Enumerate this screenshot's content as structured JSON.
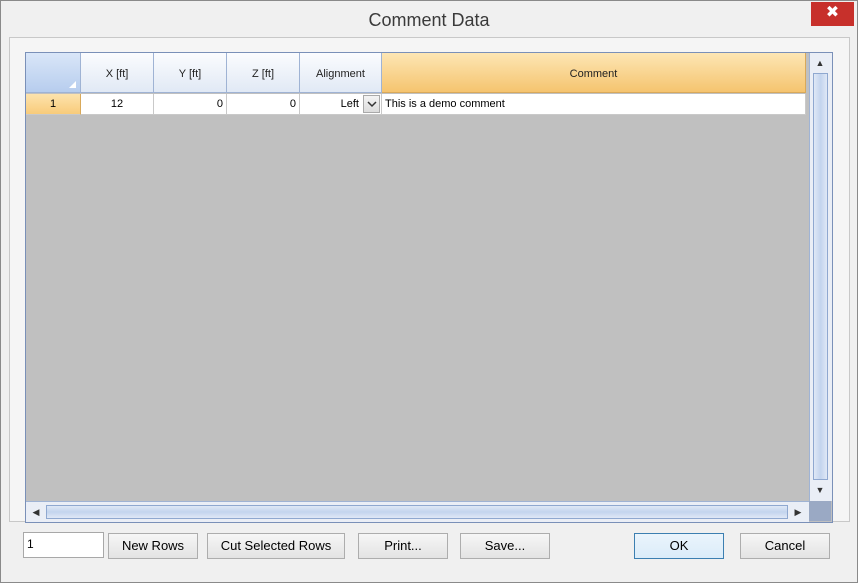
{
  "window": {
    "title": "Comment Data",
    "close_glyph": "✖"
  },
  "grid": {
    "columns": [
      "X [ft]",
      "Y [ft]",
      "Z [ft]",
      "Alignment",
      "Comment"
    ],
    "rows": [
      {
        "num": "1",
        "x": "12",
        "y": "0",
        "z": "0",
        "alignment": "Left",
        "comment": "This is a demo comment"
      }
    ]
  },
  "footer": {
    "row_count_value": "1",
    "new_rows_label": "New Rows",
    "cut_rows_label": "Cut Selected Rows",
    "print_label": "Print...",
    "save_label": "Save...",
    "ok_label": "OK",
    "cancel_label": "Cancel"
  },
  "icons": {
    "scroll_up": "▲",
    "scroll_down": "▼",
    "scroll_left": "◀",
    "scroll_right": "▶"
  },
  "colors": {
    "close_button": "#c7302b",
    "active_header": "#f5c46f",
    "grid_background": "#c0c0c0"
  }
}
